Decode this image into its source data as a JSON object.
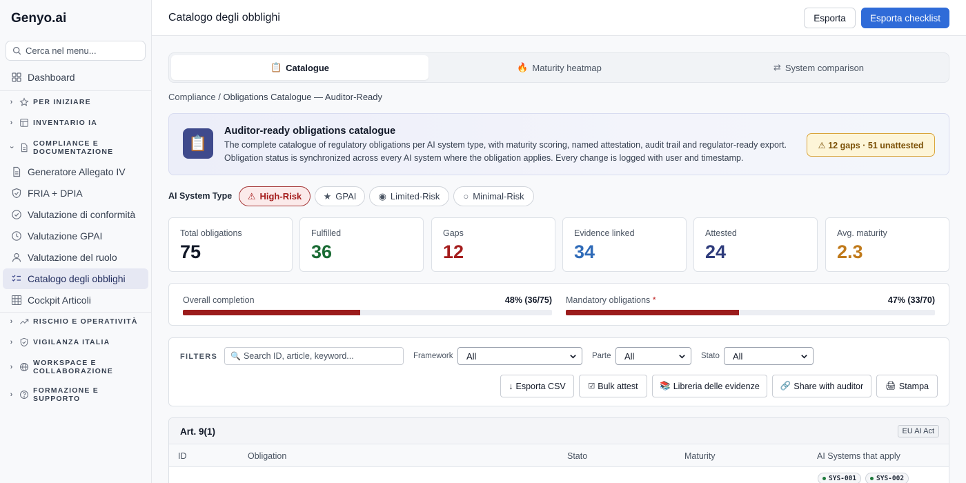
{
  "sidebar": {
    "brand": "Genyo.ai",
    "search_placeholder": "Cerca nel menu...",
    "items": [
      {
        "label": "Dashboard"
      },
      {
        "label": "PER INIZIARE"
      },
      {
        "label": "INVENTARIO IA"
      },
      {
        "label": "COMPLIANCE E DOCUMENTAZIONE"
      },
      {
        "label": "Generatore Allegato IV"
      },
      {
        "label": "FRIA + DPIA"
      },
      {
        "label": "Valutazione di conformità"
      },
      {
        "label": "Valutazione GPAI"
      },
      {
        "label": "Valutazione del ruolo"
      },
      {
        "label": "Catalogo degli obblighi"
      },
      {
        "label": "Cockpit Articoli"
      },
      {
        "label": "RISCHIO E OPERATIVITÀ"
      },
      {
        "label": "VIGILANZA ITALIA"
      },
      {
        "label": "WORKSPACE E COLLABORAZIONE"
      },
      {
        "label": "FORMAZIONE E SUPPORTO"
      }
    ]
  },
  "header": {
    "title": "Catalogo degli obblighi",
    "export_label": "Esporta",
    "export_checklist_label": "Esporta checklist"
  },
  "tabs": [
    {
      "icon": "📋",
      "label": "Catalogue"
    },
    {
      "icon": "🔥",
      "label": "Maturity heatmap"
    },
    {
      "icon": "⇄",
      "label": "System comparison"
    }
  ],
  "breadcrumb": {
    "root": "Compliance",
    "separator": " / ",
    "current": "Obligations Catalogue — Auditor-Ready"
  },
  "banner": {
    "icon": "📋",
    "title": "Auditor-ready obligations catalogue",
    "description": "The complete catalogue of regulatory obligations per AI system type, with maturity scoring, named attestation, audit trail and regulator-ready export. Obligation status is synchronized across every AI system where the obligation applies. Every change is logged with user and timestamp.",
    "badge": "⚠ 12 gaps · 51 unattested"
  },
  "system_type": {
    "label": "AI System Type",
    "options": [
      {
        "icon": "⚠",
        "label": "High-Risk"
      },
      {
        "icon": "★",
        "label": "GPAI"
      },
      {
        "icon": "◉",
        "label": "Limited-Risk"
      },
      {
        "icon": "○",
        "label": "Minimal-Risk"
      }
    ]
  },
  "stats": [
    {
      "label": "Total obligations",
      "value": "75",
      "color": "#111827"
    },
    {
      "label": "Fulfilled",
      "value": "36",
      "color": "#1a6b34"
    },
    {
      "label": "Gaps",
      "value": "12",
      "color": "#a51d1d"
    },
    {
      "label": "Evidence linked",
      "value": "34",
      "color": "#2f6bb8"
    },
    {
      "label": "Attested",
      "value": "24",
      "color": "#2f3c7c"
    },
    {
      "label": "Avg. maturity",
      "value": "2.3",
      "color": "#c07a1b"
    }
  ],
  "progress": {
    "overall": {
      "label": "Overall completion",
      "value": "48% (36/75)",
      "fraction": 0.48
    },
    "mandatory": {
      "label": "Mandatory obligations",
      "required_mark": "*",
      "value": "47% (33/70)",
      "fraction": 0.47
    }
  },
  "filters": {
    "title": "FILTERS",
    "search_placeholder": "Search ID, article, keyword...",
    "framework_label": "Framework",
    "framework_value": "All",
    "parte_label": "Parte",
    "parte_value": "All",
    "stato_label": "Stato",
    "stato_value": "All",
    "actions": [
      {
        "icon": "↓",
        "label": "Esporta CSV"
      },
      {
        "icon": "☑",
        "label": "Bulk attest"
      },
      {
        "icon": "📚",
        "label": "Libreria delle evidenze"
      },
      {
        "icon": "🔗",
        "label": "Share with auditor"
      },
      {
        "icon": "🖨",
        "label": "Stampa"
      }
    ]
  },
  "table": {
    "article": "Art. 9(1)",
    "framework_badge": "EU AI Act",
    "columns": [
      "ID",
      "Obligation",
      "Stato",
      "Maturity",
      "AI Systems that apply"
    ],
    "systems": [
      "SYS-001",
      "SYS-002"
    ]
  },
  "colors": {
    "accent": "#2f6bd8",
    "danger": "#9b1c1c",
    "sidebar_active": "#e6e8f3"
  }
}
